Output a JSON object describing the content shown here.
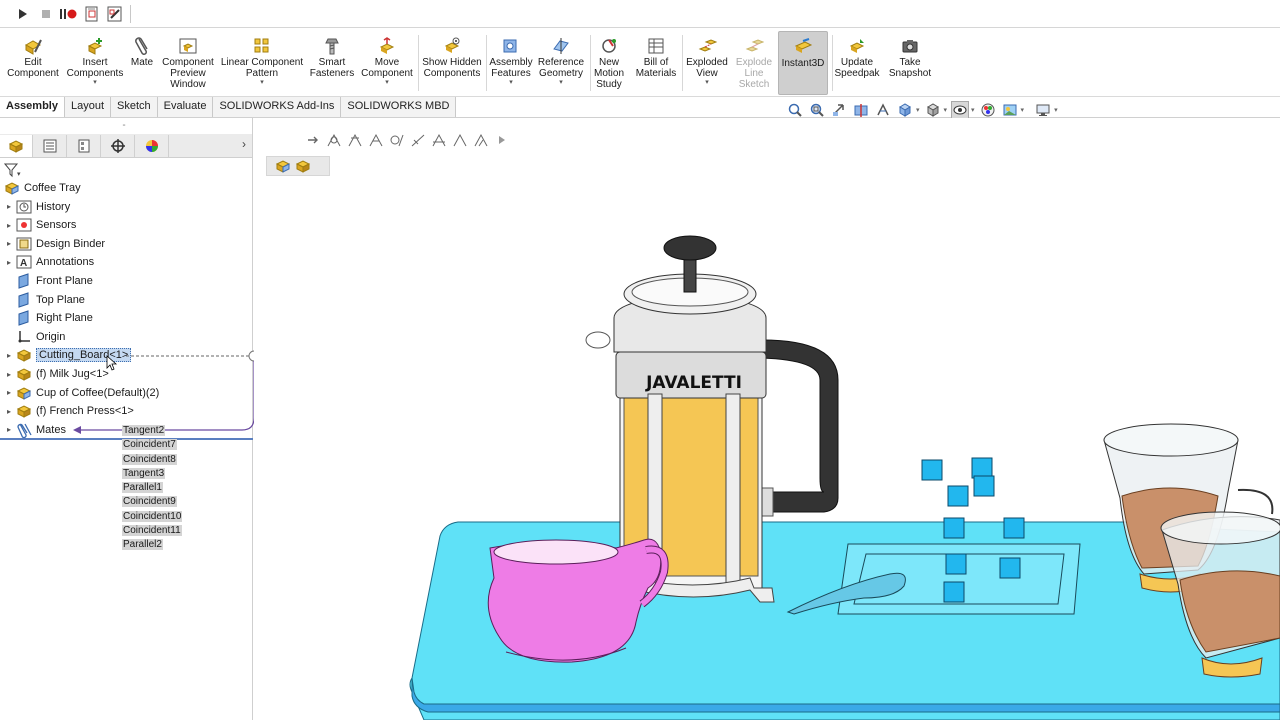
{
  "top_toolbar": {
    "icons": [
      "play-icon",
      "stop-icon",
      "pause-record-icon",
      "macro-new-icon",
      "macro-edit-icon"
    ]
  },
  "command_manager": {
    "edit_component": "Edit Component",
    "insert_components": "Insert Components",
    "mate": "Mate",
    "component_preview_window": "Component Preview Window",
    "linear_component_pattern": "Linear Component Pattern",
    "smart_fasteners": "Smart Fasteners",
    "move_component": "Move Component",
    "show_hidden_components": "Show Hidden Components",
    "assembly_features": "Assembly Features",
    "reference_geometry": "Reference Geometry",
    "new_motion_study": "New Motion Study",
    "bill_of_materials": "Bill of Materials",
    "exploded_view": "Exploded View",
    "explode_line_sketch": "Explode Line Sketch",
    "instant3d": "Instant3D",
    "update_speedpak": "Update Speedpak",
    "take_snapshot": "Take Snapshot"
  },
  "tabs": [
    "Assembly",
    "Layout",
    "Sketch",
    "Evaluate",
    "SOLIDWORKS Add-Ins",
    "SOLIDWORKS MBD"
  ],
  "active_tab": "Assembly",
  "tree": {
    "root": "Coffee Tray",
    "history": "History",
    "sensors": "Sensors",
    "design_binder": "Design Binder",
    "annotations": "Annotations",
    "front_plane": "Front Plane",
    "top_plane": "Top Plane",
    "right_plane": "Right Plane",
    "origin": "Origin",
    "cutting_board": "Cutting_Board<1>",
    "milk_jug": "(f) Milk Jug<1>",
    "cup_of_coffee": "Cup of Coffee(Default)(2)",
    "french_press": "(f) French Press<1>",
    "mates": "Mates"
  },
  "mates": [
    "Tangent2",
    "Coincident7",
    "Coincident8",
    "Tangent3",
    "Parallel1",
    "Coincident9",
    "Coincident10",
    "Coincident11",
    "Parallel2"
  ],
  "viewport": {
    "brand_text": "JAVALETTI"
  },
  "colors": {
    "tray": "#5fe1f7",
    "tray_edge": "#3aa9e8",
    "milk_jug": "#ee7ce6",
    "coffee_liquid": "#f5c654",
    "selection": "#c5d9f1",
    "mate_connector": "#6a4aa0"
  }
}
